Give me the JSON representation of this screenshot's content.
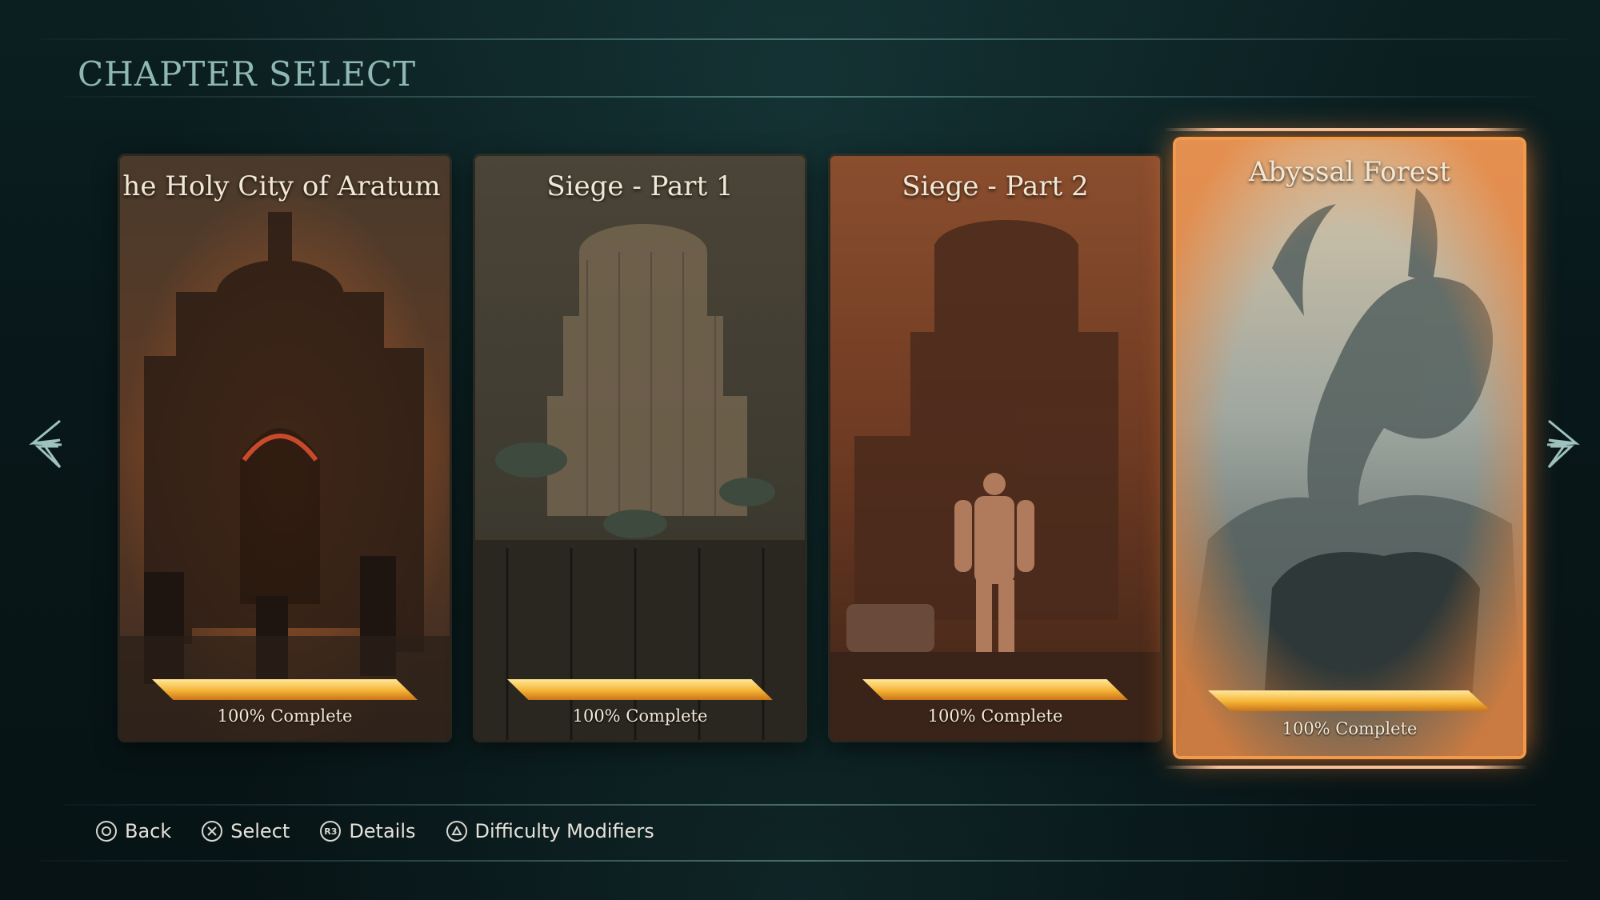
{
  "header": {
    "title": "CHAPTER SELECT"
  },
  "chapters": [
    {
      "name": "he Holy City of Aratum",
      "progress_label": "100% Complete",
      "progress": 1.0,
      "selected": false
    },
    {
      "name": "Siege - Part 1",
      "progress_label": "100% Complete",
      "progress": 1.0,
      "selected": false
    },
    {
      "name": "Siege - Part 2",
      "progress_label": "100% Complete",
      "progress": 1.0,
      "selected": false
    },
    {
      "name": "Abyssal Forest",
      "progress_label": "100% Complete",
      "progress": 1.0,
      "selected": true
    }
  ],
  "nav": {
    "left_icon": "chevron-left-icon",
    "right_icon": "chevron-right-icon"
  },
  "footer": {
    "back": {
      "label": "Back",
      "icon": "circle-button-icon"
    },
    "select": {
      "label": "Select",
      "icon": "cross-button-icon"
    },
    "details": {
      "label": "Details",
      "icon": "r3-button-icon",
      "glyph": "R3"
    },
    "difficulty": {
      "label": "Difficulty Modifiers",
      "icon": "triangle-button-icon"
    }
  },
  "colors": {
    "accent": "#f39a4a",
    "title": "#8fb7b3",
    "bar": "#f5b335"
  }
}
